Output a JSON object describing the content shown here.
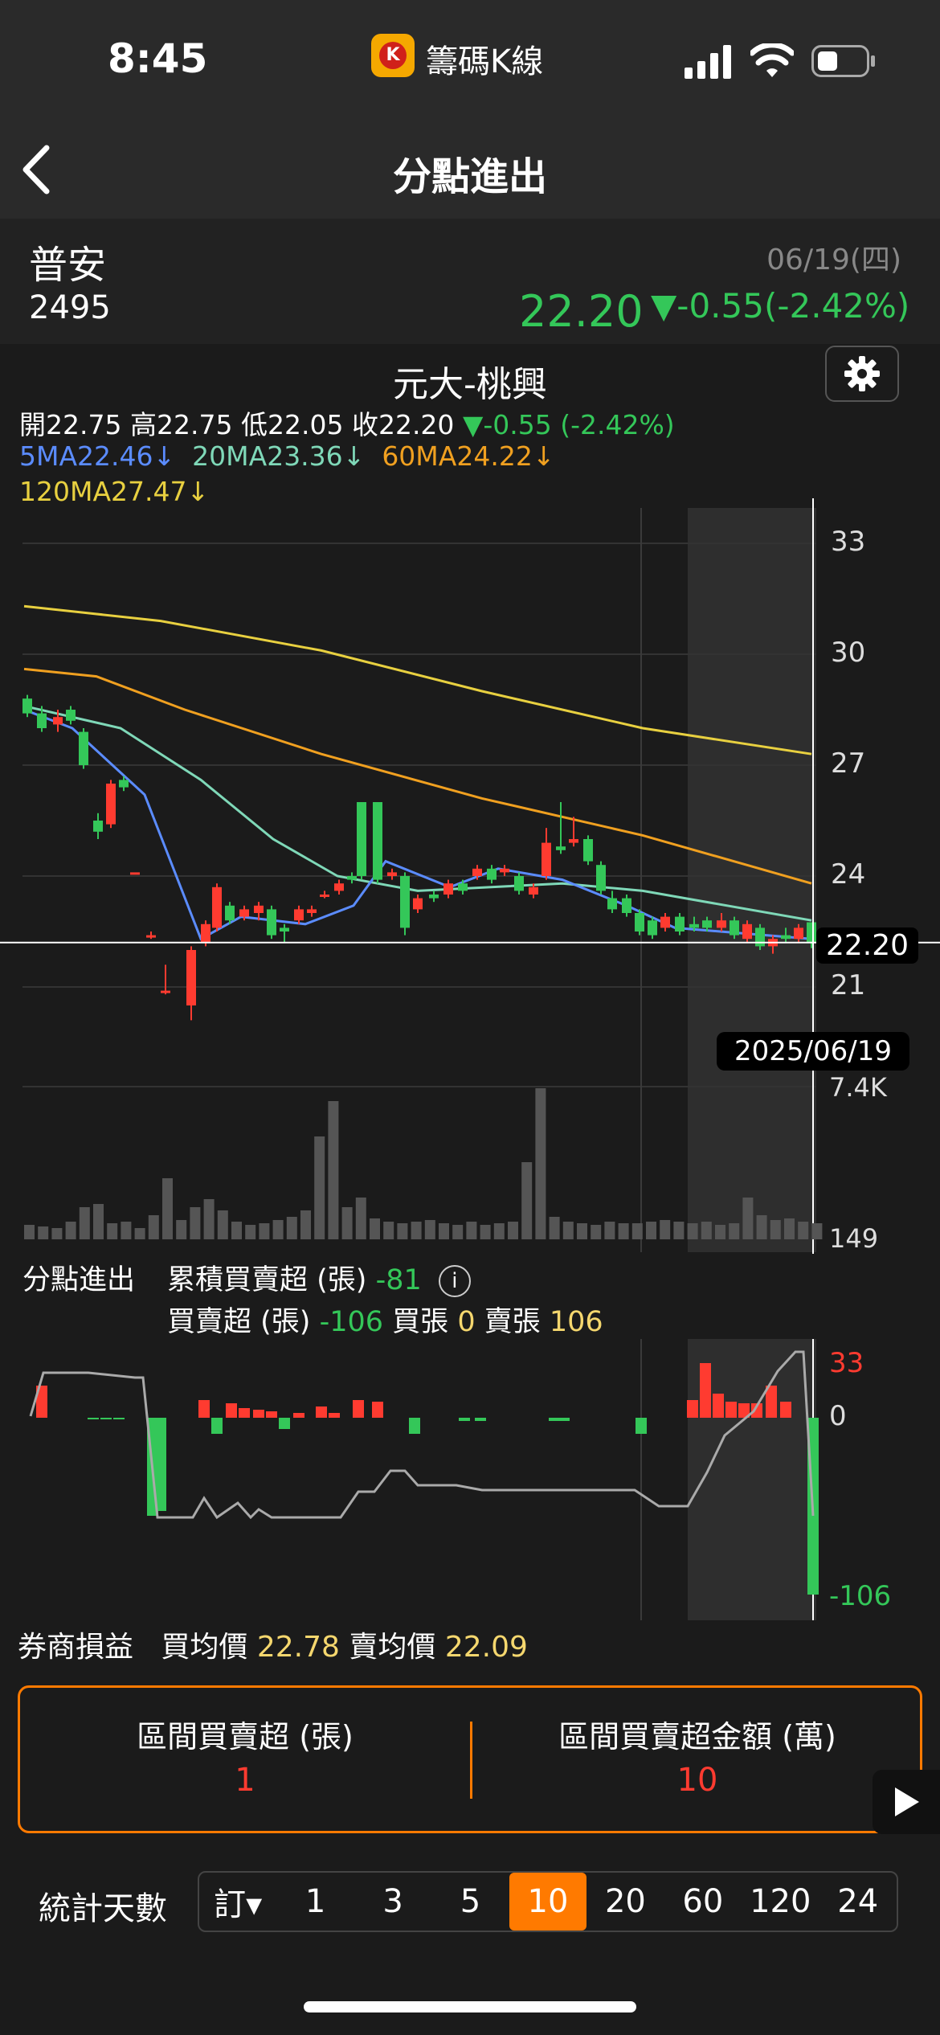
{
  "status": {
    "time": "8:45",
    "app_name": "籌碼K線"
  },
  "nav": {
    "title": "分點進出"
  },
  "stock": {
    "name": "普安",
    "code": "2495",
    "date": "06/19(四)",
    "price": "22.20",
    "change": "▼-0.55(-2.42%)"
  },
  "chart": {
    "broker": "元大-桃興",
    "ohlc": {
      "open_label": "開",
      "open": "22.75",
      "high_label": "高",
      "high": "22.75",
      "low_label": "低",
      "low": "22.05",
      "close_label": "收",
      "close": "22.20",
      "change": "▼-0.55 (-2.42%)"
    },
    "ma": {
      "ma5": "5MA22.46↓",
      "ma20": "20MA23.36↓",
      "ma60": "60MA24.22↓",
      "ma120": "120MA27.47↓"
    },
    "price_ticks": [
      "33",
      "30",
      "27",
      "24",
      "21"
    ],
    "current_price_tag": "22.20",
    "cursor_date": "2025/06/19",
    "volume_ticks": [
      "7.4K",
      "149"
    ],
    "colors": {
      "up": "#ff3b30",
      "down": "#34c759",
      "ma5": "#5b8cff",
      "ma20": "#7fd8b8",
      "ma60": "#f0a020",
      "ma120": "#e8d040"
    }
  },
  "broker_flow": {
    "label": "分點進出",
    "cum_label": "累積買賣超 (張)",
    "cum_value": "-81",
    "net_label": "買賣超 (張)",
    "net_value": "-106",
    "buy_label": "買張",
    "buy_value": "0",
    "sell_label": "賣張",
    "sell_value": "106",
    "ticks": [
      "33",
      "0",
      "-106"
    ]
  },
  "pnl": {
    "label": "券商損益",
    "buy_avg_label": "買均價",
    "buy_avg": "22.78",
    "sell_avg_label": "賣均價",
    "sell_avg": "22.09"
  },
  "stats": {
    "left_label": "區間買賣超 (張)",
    "left_value": "1",
    "right_label": "區間買賣超金額 (萬)",
    "right_value": "10"
  },
  "days": {
    "label": "統計天數",
    "options": [
      "訂▾",
      "1",
      "3",
      "5",
      "10",
      "20",
      "60",
      "120",
      "24"
    ],
    "selected": "10"
  }
}
